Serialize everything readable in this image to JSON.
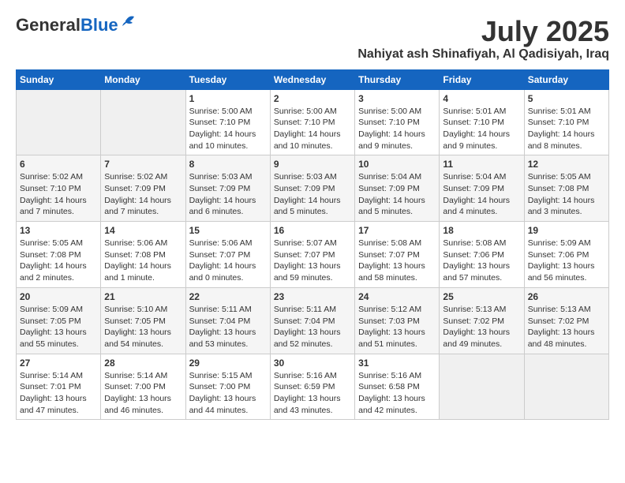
{
  "header": {
    "logo_general": "General",
    "logo_blue": "Blue",
    "month_title": "July 2025",
    "location": "Nahiyat ash Shinafiyah, Al Qadisiyah, Iraq"
  },
  "days_of_week": [
    "Sunday",
    "Monday",
    "Tuesday",
    "Wednesday",
    "Thursday",
    "Friday",
    "Saturday"
  ],
  "weeks": [
    [
      {
        "day": "",
        "info": ""
      },
      {
        "day": "",
        "info": ""
      },
      {
        "day": "1",
        "info": "Sunrise: 5:00 AM\nSunset: 7:10 PM\nDaylight: 14 hours\nand 10 minutes."
      },
      {
        "day": "2",
        "info": "Sunrise: 5:00 AM\nSunset: 7:10 PM\nDaylight: 14 hours\nand 10 minutes."
      },
      {
        "day": "3",
        "info": "Sunrise: 5:00 AM\nSunset: 7:10 PM\nDaylight: 14 hours\nand 9 minutes."
      },
      {
        "day": "4",
        "info": "Sunrise: 5:01 AM\nSunset: 7:10 PM\nDaylight: 14 hours\nand 9 minutes."
      },
      {
        "day": "5",
        "info": "Sunrise: 5:01 AM\nSunset: 7:10 PM\nDaylight: 14 hours\nand 8 minutes."
      }
    ],
    [
      {
        "day": "6",
        "info": "Sunrise: 5:02 AM\nSunset: 7:10 PM\nDaylight: 14 hours\nand 7 minutes."
      },
      {
        "day": "7",
        "info": "Sunrise: 5:02 AM\nSunset: 7:09 PM\nDaylight: 14 hours\nand 7 minutes."
      },
      {
        "day": "8",
        "info": "Sunrise: 5:03 AM\nSunset: 7:09 PM\nDaylight: 14 hours\nand 6 minutes."
      },
      {
        "day": "9",
        "info": "Sunrise: 5:03 AM\nSunset: 7:09 PM\nDaylight: 14 hours\nand 5 minutes."
      },
      {
        "day": "10",
        "info": "Sunrise: 5:04 AM\nSunset: 7:09 PM\nDaylight: 14 hours\nand 5 minutes."
      },
      {
        "day": "11",
        "info": "Sunrise: 5:04 AM\nSunset: 7:09 PM\nDaylight: 14 hours\nand 4 minutes."
      },
      {
        "day": "12",
        "info": "Sunrise: 5:05 AM\nSunset: 7:08 PM\nDaylight: 14 hours\nand 3 minutes."
      }
    ],
    [
      {
        "day": "13",
        "info": "Sunrise: 5:05 AM\nSunset: 7:08 PM\nDaylight: 14 hours\nand 2 minutes."
      },
      {
        "day": "14",
        "info": "Sunrise: 5:06 AM\nSunset: 7:08 PM\nDaylight: 14 hours\nand 1 minute."
      },
      {
        "day": "15",
        "info": "Sunrise: 5:06 AM\nSunset: 7:07 PM\nDaylight: 14 hours\nand 0 minutes."
      },
      {
        "day": "16",
        "info": "Sunrise: 5:07 AM\nSunset: 7:07 PM\nDaylight: 13 hours\nand 59 minutes."
      },
      {
        "day": "17",
        "info": "Sunrise: 5:08 AM\nSunset: 7:07 PM\nDaylight: 13 hours\nand 58 minutes."
      },
      {
        "day": "18",
        "info": "Sunrise: 5:08 AM\nSunset: 7:06 PM\nDaylight: 13 hours\nand 57 minutes."
      },
      {
        "day": "19",
        "info": "Sunrise: 5:09 AM\nSunset: 7:06 PM\nDaylight: 13 hours\nand 56 minutes."
      }
    ],
    [
      {
        "day": "20",
        "info": "Sunrise: 5:09 AM\nSunset: 7:05 PM\nDaylight: 13 hours\nand 55 minutes."
      },
      {
        "day": "21",
        "info": "Sunrise: 5:10 AM\nSunset: 7:05 PM\nDaylight: 13 hours\nand 54 minutes."
      },
      {
        "day": "22",
        "info": "Sunrise: 5:11 AM\nSunset: 7:04 PM\nDaylight: 13 hours\nand 53 minutes."
      },
      {
        "day": "23",
        "info": "Sunrise: 5:11 AM\nSunset: 7:04 PM\nDaylight: 13 hours\nand 52 minutes."
      },
      {
        "day": "24",
        "info": "Sunrise: 5:12 AM\nSunset: 7:03 PM\nDaylight: 13 hours\nand 51 minutes."
      },
      {
        "day": "25",
        "info": "Sunrise: 5:13 AM\nSunset: 7:02 PM\nDaylight: 13 hours\nand 49 minutes."
      },
      {
        "day": "26",
        "info": "Sunrise: 5:13 AM\nSunset: 7:02 PM\nDaylight: 13 hours\nand 48 minutes."
      }
    ],
    [
      {
        "day": "27",
        "info": "Sunrise: 5:14 AM\nSunset: 7:01 PM\nDaylight: 13 hours\nand 47 minutes."
      },
      {
        "day": "28",
        "info": "Sunrise: 5:14 AM\nSunset: 7:00 PM\nDaylight: 13 hours\nand 46 minutes."
      },
      {
        "day": "29",
        "info": "Sunrise: 5:15 AM\nSunset: 7:00 PM\nDaylight: 13 hours\nand 44 minutes."
      },
      {
        "day": "30",
        "info": "Sunrise: 5:16 AM\nSunset: 6:59 PM\nDaylight: 13 hours\nand 43 minutes."
      },
      {
        "day": "31",
        "info": "Sunrise: 5:16 AM\nSunset: 6:58 PM\nDaylight: 13 hours\nand 42 minutes."
      },
      {
        "day": "",
        "info": ""
      },
      {
        "day": "",
        "info": ""
      }
    ]
  ]
}
